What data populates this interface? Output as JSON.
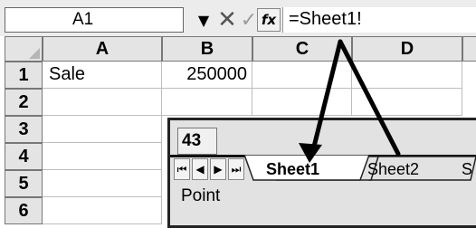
{
  "formula_bar": {
    "name_box_value": "A1",
    "dropdown_glyph": "▼",
    "cancel_glyph": "✕",
    "enter_glyph": "✓",
    "fx_glyph": "fx",
    "formula_value": "=Sheet1!"
  },
  "grid": {
    "columns": [
      "A",
      "B",
      "C",
      "D"
    ],
    "rows": [
      "1",
      "2",
      "3",
      "4",
      "5",
      "6"
    ],
    "cells": {
      "a1": "Sale",
      "b1": "250000"
    }
  },
  "sheet_popup": {
    "row_indicator": "43",
    "nav": {
      "first": "⏮",
      "prev": "◀",
      "next": "▶",
      "last": "⏭"
    },
    "tabs": [
      "Sheet1",
      "Sheet2",
      "S"
    ],
    "active_tab": "Sheet1",
    "status": "Point"
  },
  "icons": {
    "name_box_dropdown": "chevron-down-icon",
    "cancel": "close-icon",
    "enter": "check-icon",
    "insert_function": "function-icon",
    "tab_first": "first-sheet-icon",
    "tab_prev": "previous-sheet-icon",
    "tab_next": "next-sheet-icon",
    "tab_last": "last-sheet-icon"
  },
  "colors": {
    "header_bg": "#e4e4e4",
    "active_tab_bg": "#ffffff",
    "arrow": "#000000"
  }
}
